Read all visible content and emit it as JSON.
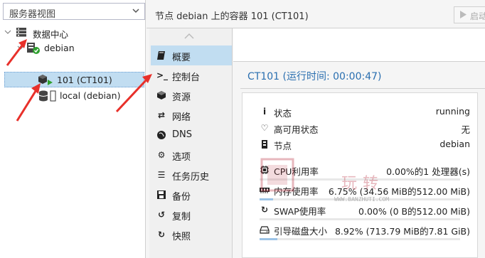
{
  "left_panel": {
    "view_select": "服务器视图",
    "tree": {
      "datacenter": "数据中心",
      "node": "debian",
      "vm": "101 (CT101)",
      "storage": "local (debian)"
    }
  },
  "header": {
    "title": "节点 debian 上的容器 101 (CT101)",
    "start_label": "启动"
  },
  "nav": {
    "items": [
      {
        "label": "概要",
        "icon": "book-icon"
      },
      {
        "label": "控制台",
        "icon": "terminal-icon"
      },
      {
        "label": "资源",
        "icon": "cube-icon"
      },
      {
        "label": "网络",
        "icon": "exchange-icon"
      },
      {
        "label": "DNS",
        "icon": "globe-icon"
      },
      {
        "label": "选项",
        "icon": "gear-icon"
      },
      {
        "label": "任务历史",
        "icon": "list-icon"
      },
      {
        "label": "备份",
        "icon": "floppy-icon"
      },
      {
        "label": "复制",
        "icon": "retweet-icon"
      },
      {
        "label": "快照",
        "icon": "history-icon"
      }
    ],
    "active_index": 0
  },
  "summary": {
    "title": "CT101 (运行时间: 00:00:47)",
    "status_label": "状态",
    "status_value": "running",
    "ha_label": "高可用状态",
    "ha_value": "无",
    "node_label": "节点",
    "node_value": "debian",
    "cpu_label": "CPU利用率",
    "cpu_value": "0.00%的1 处理器(s)",
    "cpu_fraction": 0.0,
    "mem_label": "内存使用率",
    "mem_value": "6.75% (34.56 MiB的512.00 MiB)",
    "mem_fraction": 0.0675,
    "swap_label": "SWAP使用率",
    "swap_value": "0.00% (0 B的512.00 MiB)",
    "swap_fraction": 0.0,
    "disk_label": "引导磁盘大小",
    "disk_value": "8.92% (713.79 MiB的7.81 GiB)",
    "disk_fraction": 0.0892
  },
  "watermark": {
    "text": "玩转",
    "url": "WWW.BANZHUTI.COM"
  },
  "colors": {
    "selection": "#c1ddf1",
    "accent": "#2a6fb0",
    "arrow": "#e8302a",
    "running_green": "#2ea02e"
  }
}
